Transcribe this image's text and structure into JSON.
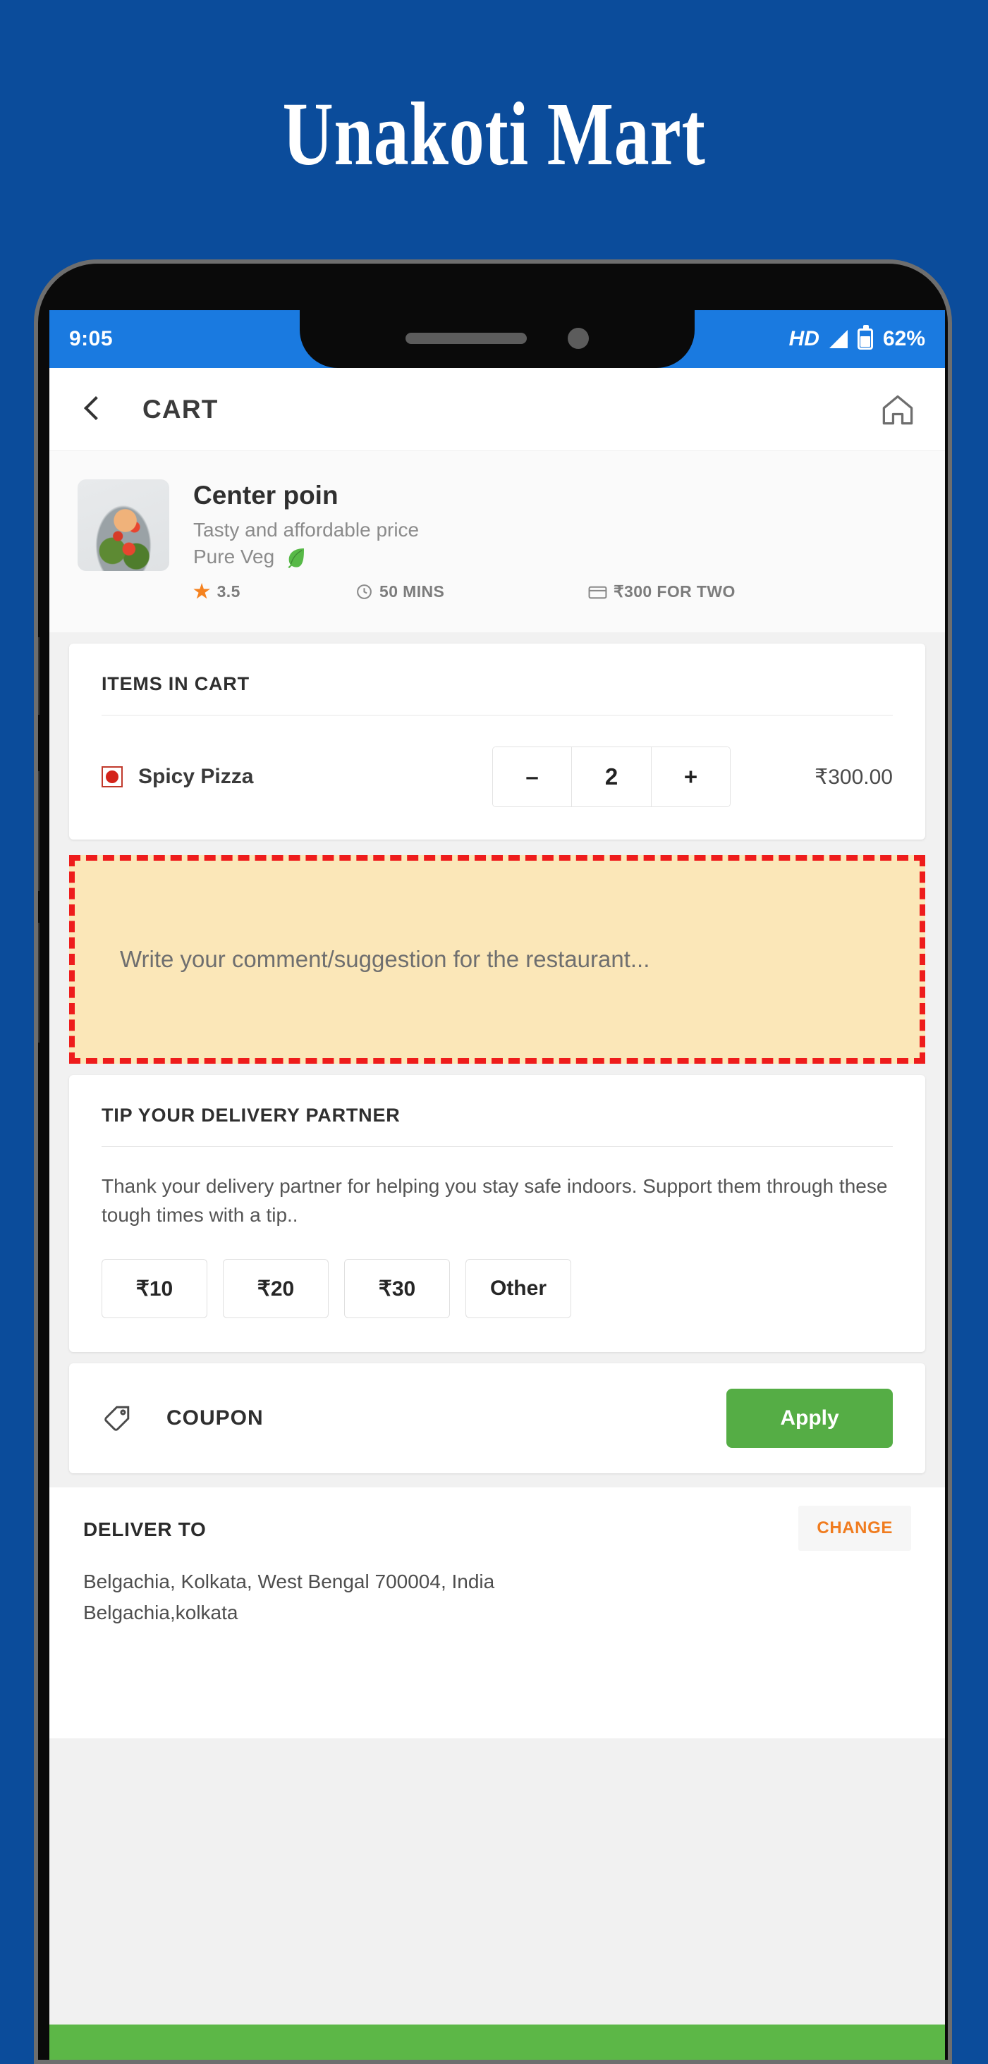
{
  "banner": {
    "title": "Unakoti Mart",
    "background_color": "#0B4C9B"
  },
  "status_bar": {
    "time": "9:05",
    "hd_label": "HD",
    "battery_percent": "62%",
    "background_color": "#1A7AE0",
    "icons": [
      "signal-icon",
      "battery-icon"
    ]
  },
  "app_bar": {
    "back_icon": "back-chevron-icon",
    "title": "CART",
    "home_icon": "home-icon"
  },
  "restaurant": {
    "name": "Center poin",
    "tagline": "Tasty and affordable price",
    "veg_label": "Pure Veg",
    "veg_icon": "leaf-icon",
    "rating": "3.5",
    "rating_icon": "star-icon",
    "delivery_time": "50 MINS",
    "time_icon": "clock-icon",
    "cost_for_two": "₹300 FOR TWO",
    "cost_icon": "wallet-icon"
  },
  "items_card": {
    "heading": "ITEMS IN CART",
    "items": [
      {
        "veg_indicator": "non-veg-red",
        "name": "Spicy Pizza",
        "decrement": "–",
        "quantity": "2",
        "increment": "+",
        "price": "₹300.00"
      }
    ]
  },
  "comment_box": {
    "placeholder": "Write your comment/suggestion for the restaurant...",
    "background_color": "#FBE7B8",
    "highlight_color": "#EE1C1C"
  },
  "tip_card": {
    "heading": "TIP YOUR DELIVERY PARTNER",
    "description": "Thank your delivery partner for helping you stay safe indoors. Support them through these tough times with a tip..",
    "options": [
      "₹10",
      "₹20",
      "₹30",
      "Other"
    ]
  },
  "coupon_card": {
    "icon": "tag-icon",
    "label": "COUPON",
    "apply_label": "Apply",
    "apply_color": "#55AD45"
  },
  "deliver_to": {
    "heading": "DELIVER TO",
    "change_label": "CHANGE",
    "change_color": "#F07C1F",
    "address_line1": "Belgachia, Kolkata, West Bengal 700004, India",
    "address_line2": "Belgachia,kolkata"
  },
  "bottom_bar": {
    "color": "#5CB747"
  }
}
